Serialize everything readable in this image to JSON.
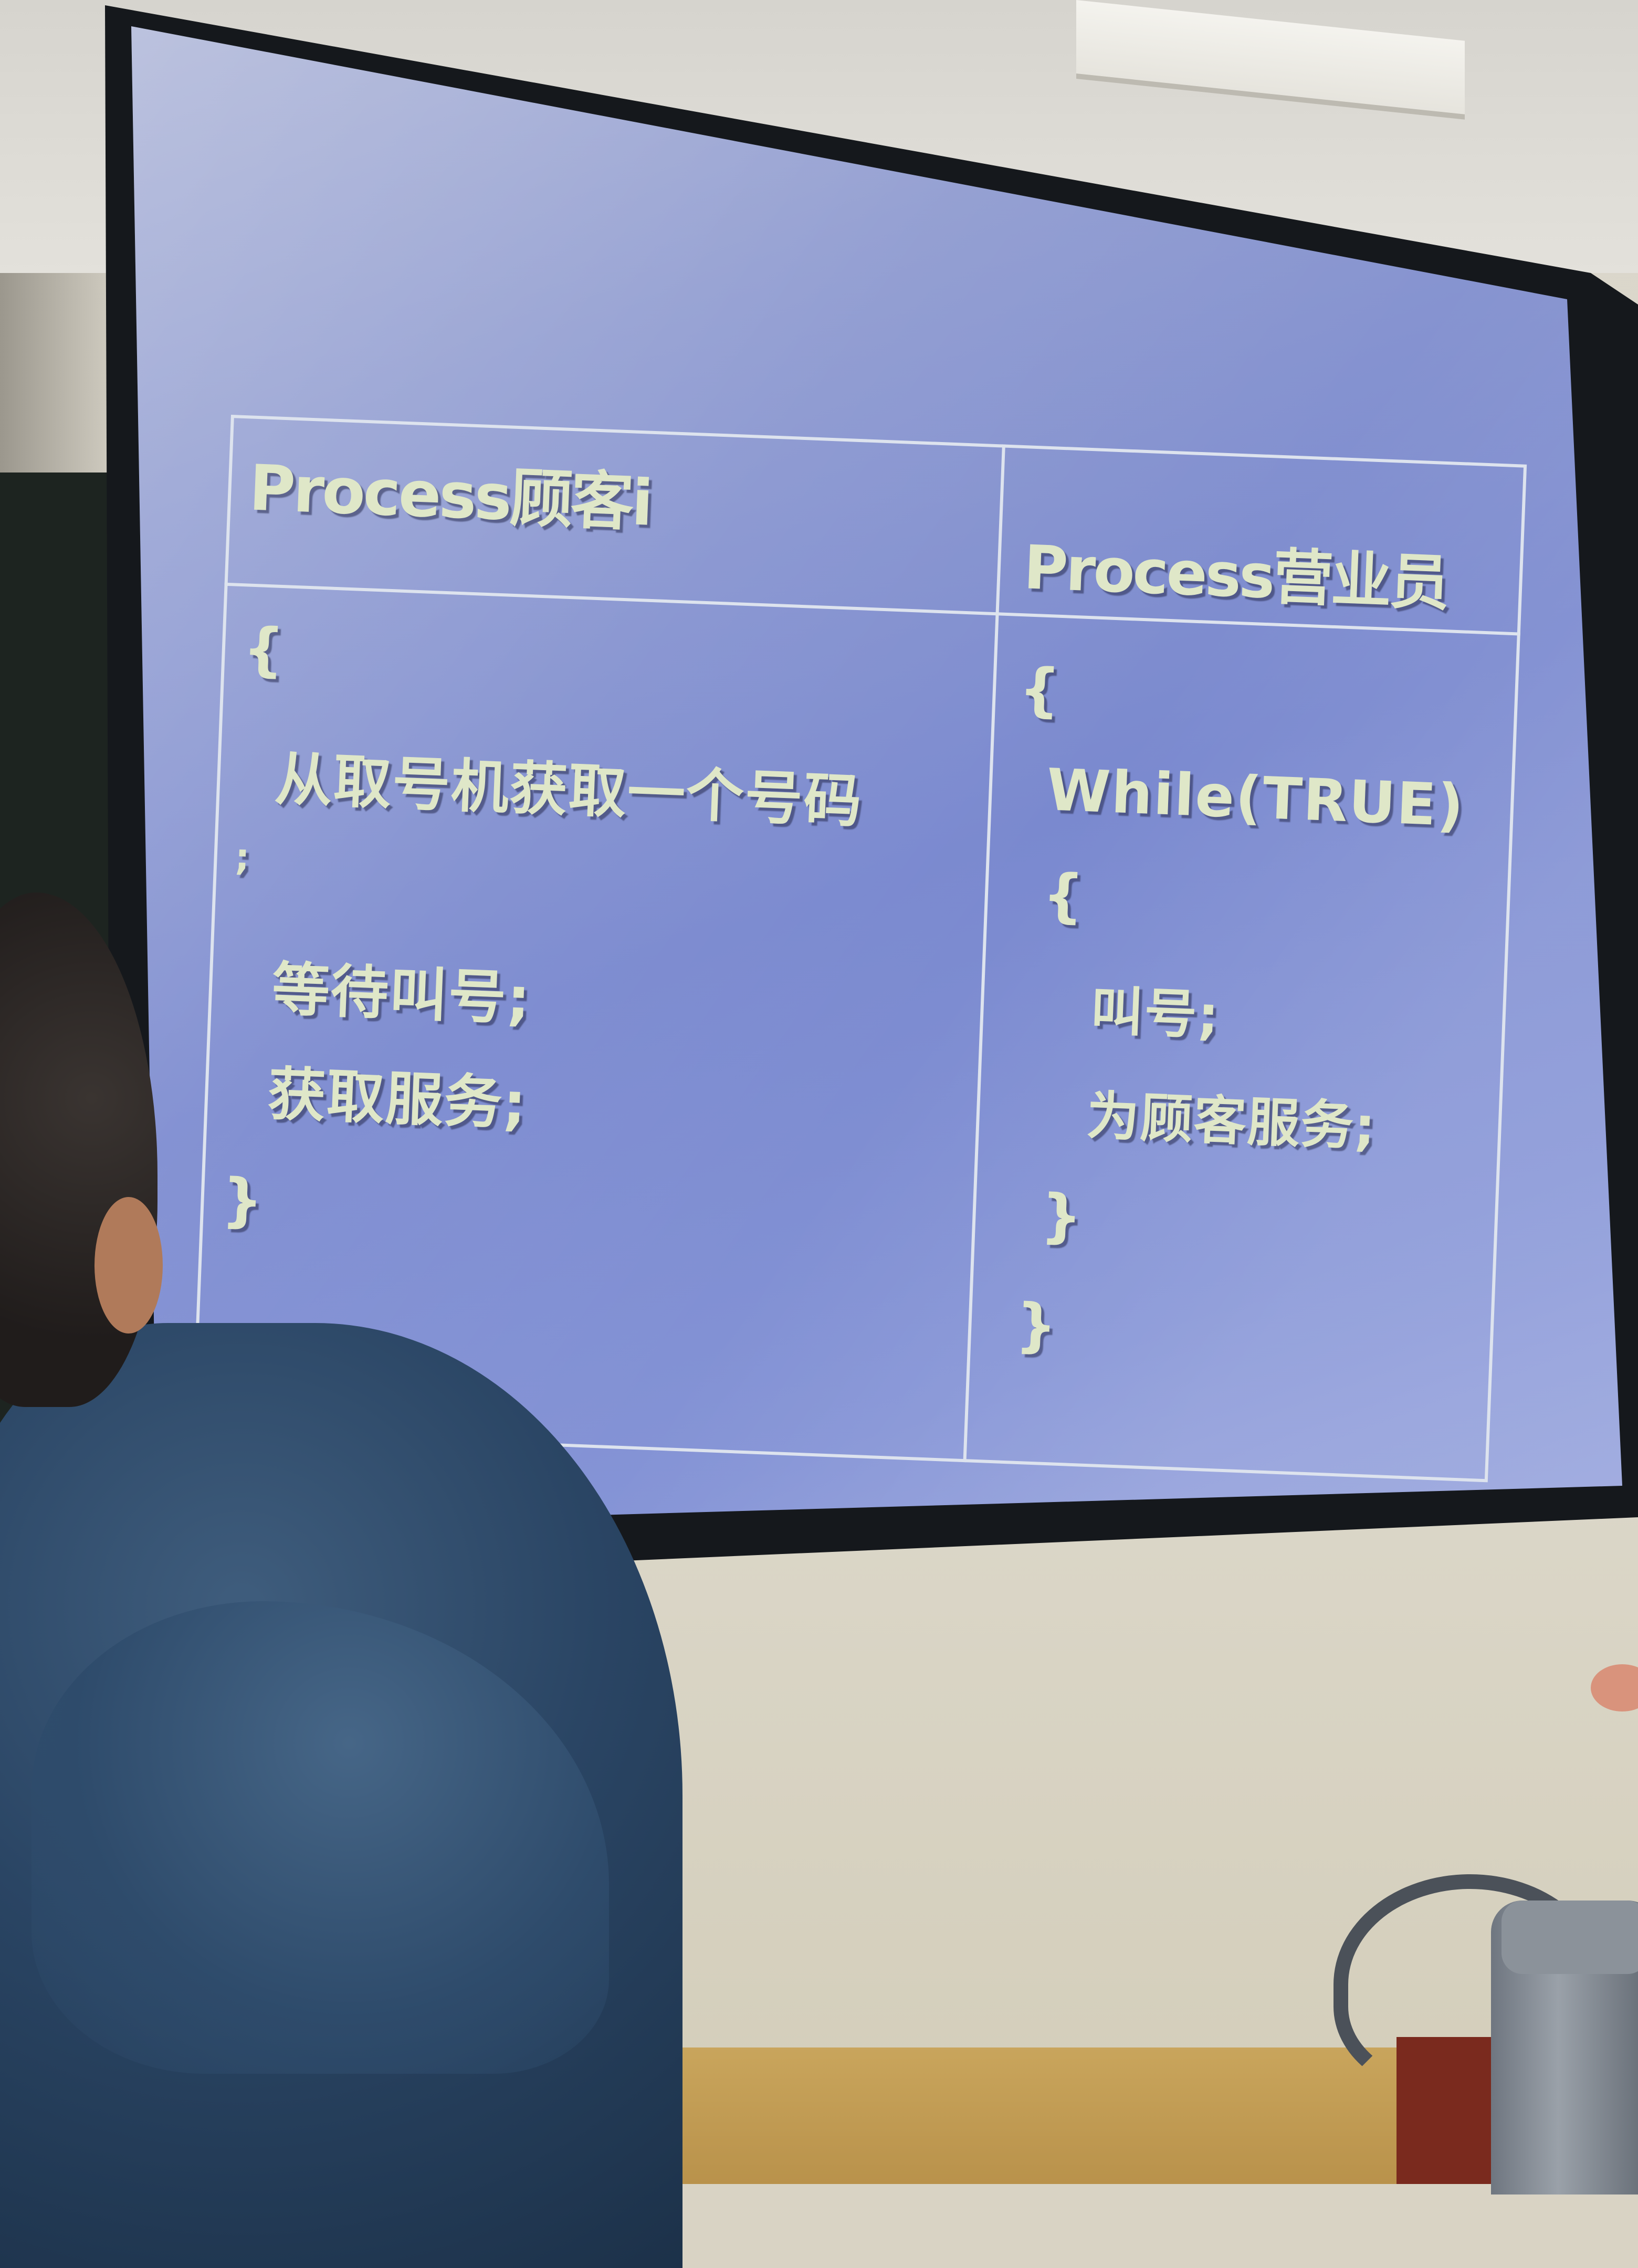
{
  "slide": {
    "left_header": "Process顾客i",
    "right_header": "Process营业员",
    "left_code": [
      "{",
      "从取号机获取一个号码",
      ";",
      "等待叫号;",
      "获取服务;",
      "}"
    ],
    "right_code": [
      "{",
      "While(TRUE)",
      "{",
      "叫号;",
      "为顾客服务;",
      "}",
      "}"
    ]
  },
  "colors": {
    "screen": "#8594d6",
    "slide_text": "#dfe7c8",
    "table_lines": "#dde3ee",
    "hoodie": "#2a4564"
  }
}
